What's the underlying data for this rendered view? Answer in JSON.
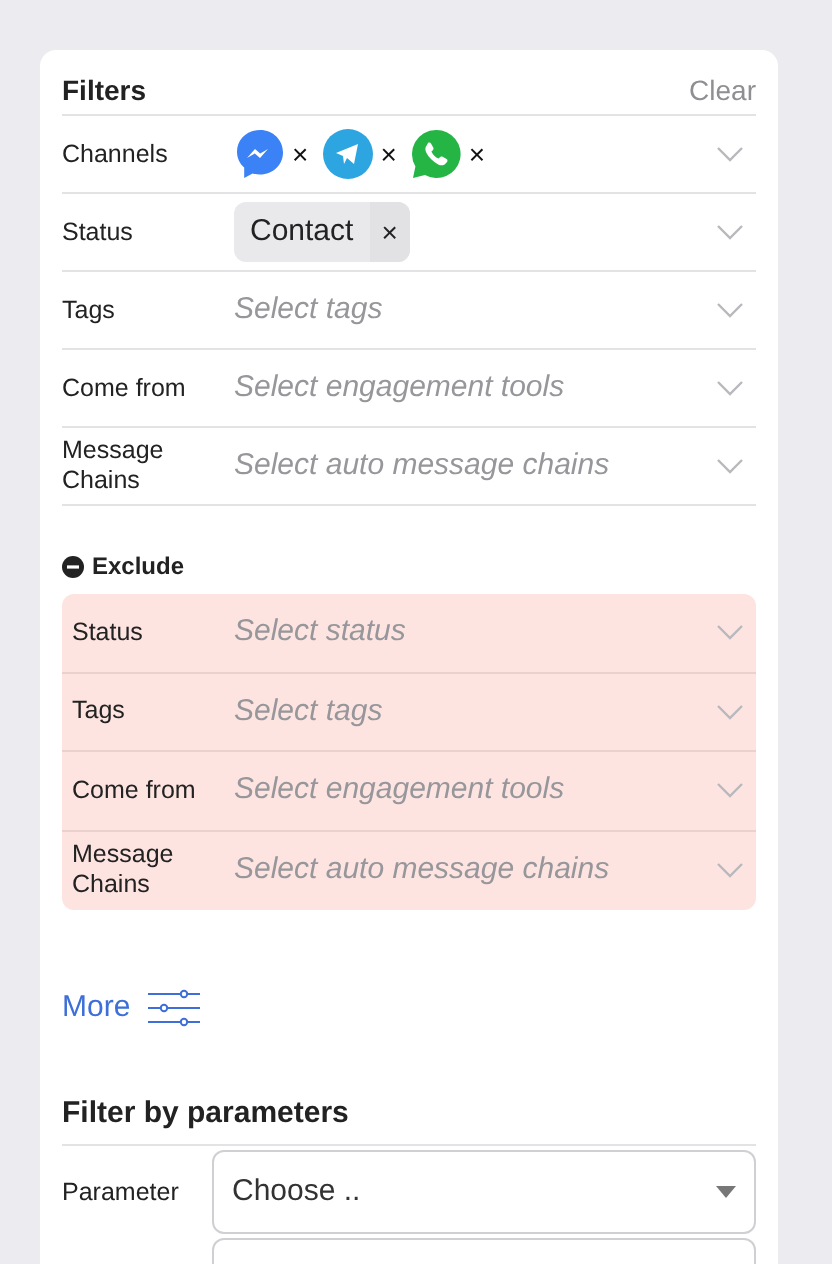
{
  "header": {
    "title": "Filters",
    "clear": "Clear"
  },
  "include": [
    {
      "label": "Channels",
      "kind": "channels",
      "channels": [
        {
          "kind": "messenger",
          "remove": "×"
        },
        {
          "kind": "telegram",
          "remove": "×"
        },
        {
          "kind": "whatsapp",
          "remove": "×"
        }
      ]
    },
    {
      "label": "Status",
      "kind": "chips",
      "chips": [
        {
          "text": "Contact",
          "remove": "×"
        }
      ]
    },
    {
      "label": "Tags",
      "kind": "placeholder",
      "placeholder": "Select tags"
    },
    {
      "label": "Come from",
      "kind": "placeholder",
      "placeholder": "Select engagement tools"
    },
    {
      "label": "Message Chains",
      "kind": "placeholder",
      "placeholder": "Select auto message chains"
    }
  ],
  "exclude": {
    "title": "Exclude",
    "rows": [
      {
        "label": "Status",
        "placeholder": "Select status"
      },
      {
        "label": "Tags",
        "placeholder": "Select tags"
      },
      {
        "label": "Come from",
        "placeholder": "Select engagement tools"
      },
      {
        "label": "Message Chains",
        "placeholder": "Select auto message chains"
      }
    ]
  },
  "more": "More",
  "parameters": {
    "title": "Filter by parameters",
    "rows": [
      {
        "label": "Parameter",
        "value": "Choose .."
      }
    ]
  }
}
